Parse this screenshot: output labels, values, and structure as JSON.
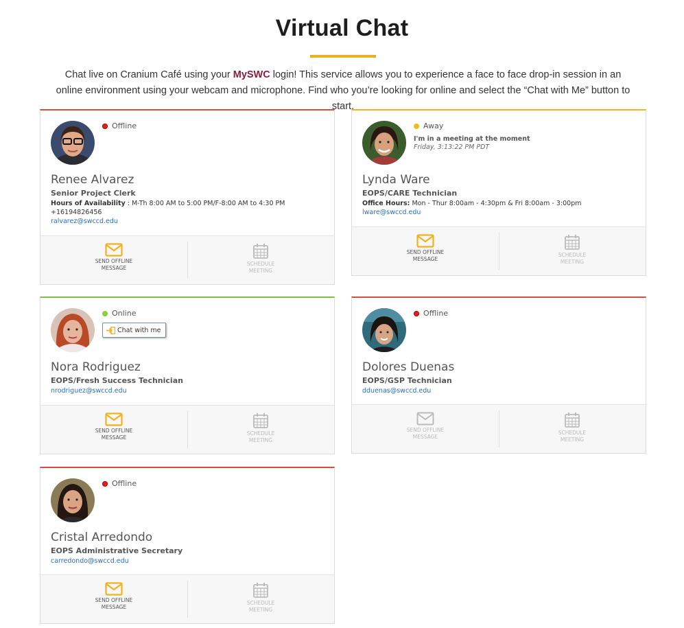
{
  "page": {
    "title": "Virtual Chat",
    "intro_before": "Chat live on Cranium Café using your ",
    "intro_brand": "MySWC",
    "intro_after": " login! This service allows you to experience a face to face drop-in session in an online environment using your webcam and microphone. Find who you’re looking for online and select the “Chat with Me” button to start."
  },
  "colors": {
    "accent": "#eab024",
    "brand": "#8d1b3d",
    "offline": "#d94b3b",
    "away": "#f2b21b",
    "online": "#7dc142",
    "link": "#2a6ebb"
  },
  "actions": {
    "send_label_1": "Send Offline",
    "send_label_2": "Message",
    "schedule_label_1": "Schedule",
    "schedule_label_2": "Meeting"
  },
  "staff": [
    {
      "name": "Renee Alvarez",
      "role": "Senior Project Clerk",
      "status": "Offline",
      "hours_label": "Hours of Availability",
      "hours": " : M-Th 8:00 AM to 5:00 PM/F-8:00 AM to 4:30 PM",
      "phone": "+16194826456",
      "email": "ralvarez@swccd.edu"
    },
    {
      "name": "Lynda Ware",
      "role": "EOPS/CARE Technician",
      "status": "Away",
      "away_message": "I'm in a meeting at the moment",
      "away_time": "Friday, 3:13:22 PM PDT",
      "hours_label": "Office Hours:",
      "hours": " Mon - Thur 8:00am - 4:30pm & Fri 8:00am - 3:00pm",
      "email": "lware@swccd.edu"
    },
    {
      "name": "Nora Rodriguez",
      "role": "EOPS/Fresh Success Technician",
      "status": "Online",
      "chat_label": "Chat with me",
      "email": "nrodriguez@swccd.edu"
    },
    {
      "name": "Dolores Duenas",
      "role": "EOPS/GSP Technician",
      "status": "Offline",
      "email": "dduenas@swccd.edu"
    },
    {
      "name": "Cristal Arredondo",
      "role": "EOPS Administrative Secretary",
      "status": "Offline",
      "email": "carredondo@swccd.edu"
    }
  ]
}
